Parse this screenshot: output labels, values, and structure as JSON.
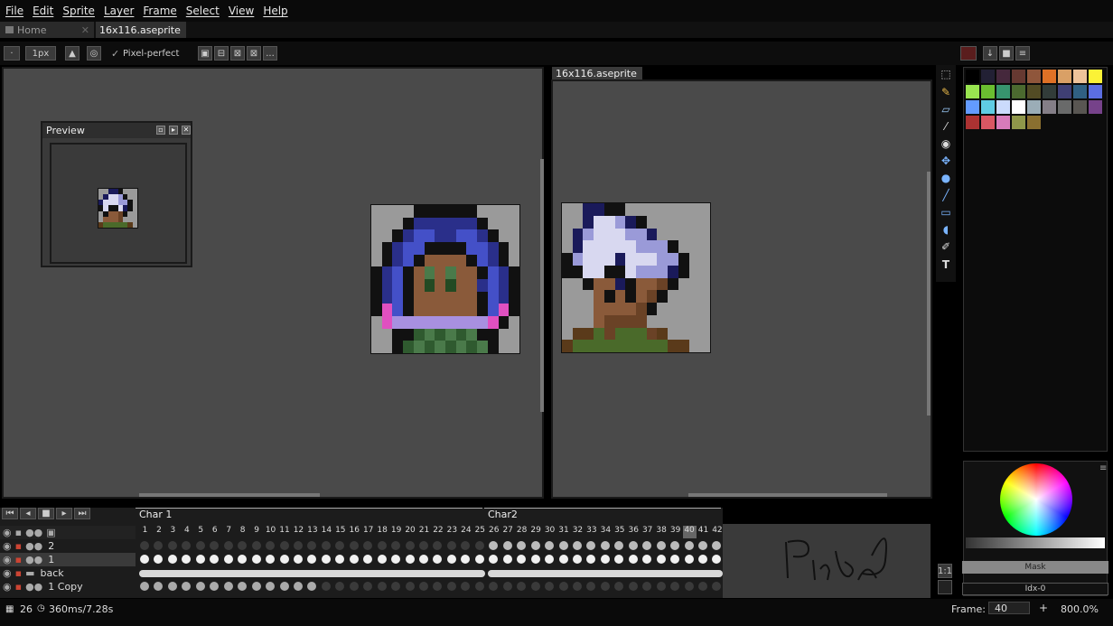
{
  "menu": {
    "items": [
      "File",
      "Edit",
      "Sprite",
      "Layer",
      "Frame",
      "Select",
      "View",
      "Help"
    ]
  },
  "tabs": {
    "home": "Home",
    "file": "16x116.aseprite"
  },
  "toolbar": {
    "brush_size": "1px",
    "pixel_perfect": "Pixel-perfect",
    "more": "..."
  },
  "preview": {
    "title": "Preview"
  },
  "right_editor": {
    "tab": "16x116.aseprite"
  },
  "timeline": {
    "tags": [
      "Char 1",
      "Char2"
    ],
    "frames": [
      "1",
      "2",
      "3",
      "4",
      "5",
      "6",
      "7",
      "8",
      "9",
      "10",
      "11",
      "12",
      "13",
      "14",
      "15",
      "16",
      "17",
      "18",
      "19",
      "20",
      "21",
      "22",
      "23",
      "24",
      "25",
      "26",
      "27",
      "28",
      "29",
      "30",
      "31",
      "32",
      "33",
      "34",
      "35",
      "36",
      "37",
      "38",
      "39",
      "40",
      "41",
      "42"
    ],
    "layers": [
      "2",
      "1",
      "back",
      "1 Copy"
    ],
    "current_frame_index": 39
  },
  "color_panel": {
    "mask_label": "Mask",
    "idx_label": "Idx-0"
  },
  "status": {
    "frames": "26",
    "duration": "360ms/7.28s",
    "frame_label": "Frame:",
    "frame_value": "40",
    "zoom": "800.0%"
  },
  "palette": {
    "colors": [
      "#000000",
      "#222034",
      "#45283c",
      "#663931",
      "#8f563b",
      "#df7126",
      "#d9a066",
      "#eec39a",
      "#fbf236",
      "#99e550",
      "#6abe30",
      "#37946e",
      "#4b692f",
      "#524b24",
      "#323c39",
      "#3f3f74",
      "#306082",
      "#5b6ee1",
      "#639bff",
      "#5fcde4",
      "#cbdbfc",
      "#ffffff",
      "#9badb7",
      "#847e87",
      "#696a6a",
      "#595652",
      "#76428a",
      "#ac3232",
      "#d95763",
      "#d77bba",
      "#8f974a",
      "#8a6f30"
    ]
  },
  "icons": {
    "tools": [
      "marquee-icon",
      "pencil-icon",
      "eraser-icon",
      "eyedropper-icon",
      "zoom-icon",
      "move-icon",
      "fill-icon",
      "line-icon",
      "rectangle-icon",
      "ellipse-icon",
      "blur-icon",
      "text-icon"
    ]
  }
}
